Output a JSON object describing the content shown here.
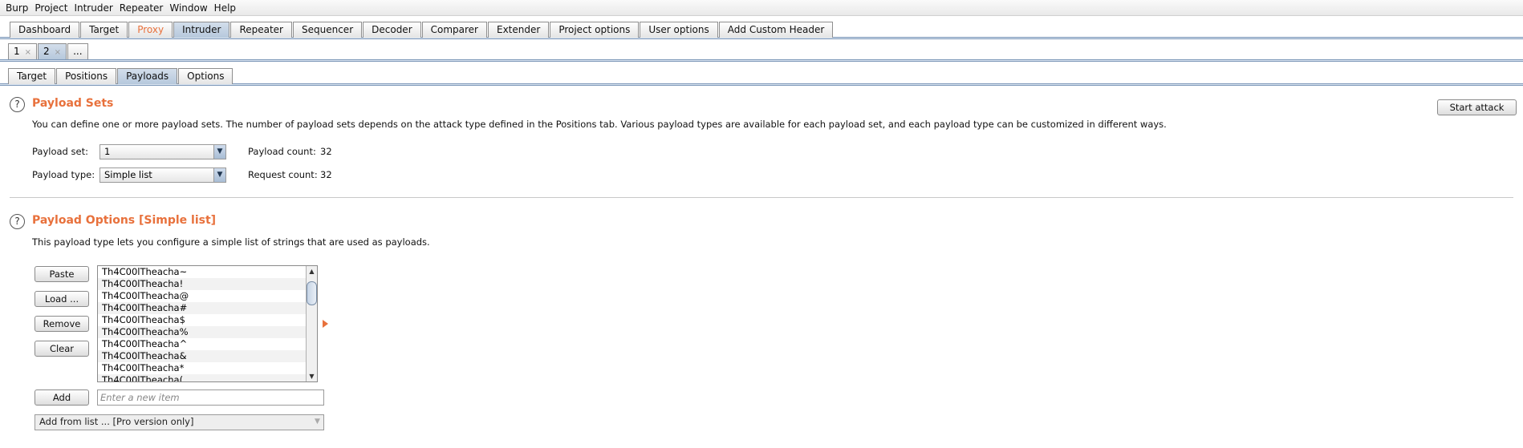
{
  "menu": [
    "Burp",
    "Project",
    "Intruder",
    "Repeater",
    "Window",
    "Help"
  ],
  "main_tabs": [
    {
      "label": "Dashboard",
      "state": "normal"
    },
    {
      "label": "Target",
      "state": "normal"
    },
    {
      "label": "Proxy",
      "state": "highlight"
    },
    {
      "label": "Intruder",
      "state": "active"
    },
    {
      "label": "Repeater",
      "state": "normal"
    },
    {
      "label": "Sequencer",
      "state": "normal"
    },
    {
      "label": "Decoder",
      "state": "normal"
    },
    {
      "label": "Comparer",
      "state": "normal"
    },
    {
      "label": "Extender",
      "state": "normal"
    },
    {
      "label": "Project options",
      "state": "normal"
    },
    {
      "label": "User options",
      "state": "normal"
    },
    {
      "label": "Add Custom Header",
      "state": "normal"
    }
  ],
  "attack_tabs": [
    {
      "label": "1",
      "close": "×"
    },
    {
      "label": "2",
      "close": "×"
    },
    {
      "label": "...",
      "close": ""
    }
  ],
  "pane_tabs": [
    "Target",
    "Positions",
    "Payloads",
    "Options"
  ],
  "payload_sets": {
    "help": "?",
    "title": "Payload Sets",
    "description": "You can define one or more payload sets. The number of payload sets depends on the attack type defined in the Positions tab. Various payload types are available for each payload set, and each payload type can be customized in different ways.",
    "set_label": "Payload set:",
    "set_value": "1",
    "type_label": "Payload type:",
    "type_value": "Simple list",
    "payload_count_label": "Payload count:",
    "payload_count": "32",
    "request_count_label": "Request count:",
    "request_count": "32",
    "start_attack": "Start attack"
  },
  "payload_options": {
    "help": "?",
    "title": "Payload Options [Simple list]",
    "description": "This payload type lets you configure a simple list of strings that are used as payloads.",
    "buttons": {
      "paste": "Paste",
      "load": "Load ...",
      "remove": "Remove",
      "clear": "Clear",
      "add": "Add"
    },
    "items": [
      "Th4C00lTheacha~",
      "Th4C00lTheacha!",
      "Th4C00lTheacha@",
      "Th4C00lTheacha#",
      "Th4C00lTheacha$",
      "Th4C00lTheacha%",
      "Th4C00lTheacha^",
      "Th4C00lTheacha&",
      "Th4C00lTheacha*",
      "Th4C00lTheacha("
    ],
    "new_item_placeholder": "Enter a new item",
    "add_from_list": "Add from list ... [Pro version only]"
  },
  "colors": {
    "accent": "#e8713c",
    "tab_active": "#b6c8dc",
    "separator": "#7c97b8"
  },
  "icons": {
    "combo_arrow": "triangle-down-icon",
    "scroll_up": "triangle-up-icon",
    "scroll_down": "triangle-down-icon",
    "help": "question-circle-icon",
    "list_arrow": "triangle-right-icon"
  }
}
